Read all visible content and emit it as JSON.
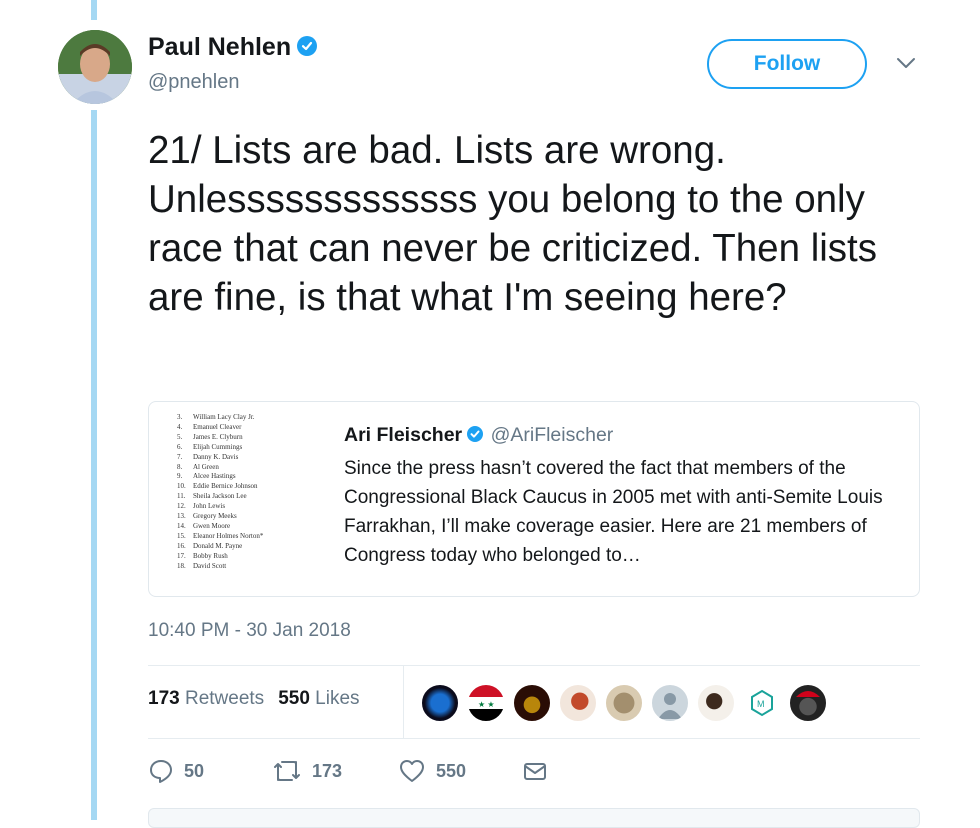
{
  "tweet": {
    "author_name": "Paul Nehlen",
    "handle": "@pnehlen",
    "follow_label": "Follow",
    "text": "21/ Lists are bad. Lists are wrong. Unlesssssssssssss you belong to the only race that can never be criticized. Then lists are fine, is that what I'm seeing here?",
    "timestamp": "10:40 PM - 30 Jan 2018"
  },
  "quote": {
    "author_name": "Ari Fleischer",
    "handle": "@AriFleischer",
    "text": "Since the press hasn’t covered the fact that members of the Congressional Black Caucus in 2005 met with anti-Semite Louis Farrakhan, I’ll make coverage easier. Here are 21 members of Congress today who belonged to…",
    "thumb_lines": [
      {
        "num": "3.",
        "name": "William Lacy Clay Jr."
      },
      {
        "num": "4.",
        "name": "Emanuel Cleaver"
      },
      {
        "num": "5.",
        "name": "James E. Clyburn"
      },
      {
        "num": "6.",
        "name": "Elijah Cummings"
      },
      {
        "num": "7.",
        "name": "Danny K. Davis"
      },
      {
        "num": "8.",
        "name": "Al Green"
      },
      {
        "num": "9.",
        "name": "Alcee Hastings"
      },
      {
        "num": "10.",
        "name": "Eddie Bernice Johnson"
      },
      {
        "num": "11.",
        "name": "Sheila Jackson Lee"
      },
      {
        "num": "12.",
        "name": "John Lewis"
      },
      {
        "num": "13.",
        "name": "Gregory Meeks"
      },
      {
        "num": "14.",
        "name": "Gwen Moore"
      },
      {
        "num": "15.",
        "name": "Eleanor Holmes Norton*"
      },
      {
        "num": "16.",
        "name": "Donald M. Payne"
      },
      {
        "num": "17.",
        "name": "Bobby Rush"
      },
      {
        "num": "18.",
        "name": "David Scott"
      }
    ]
  },
  "stats": {
    "retweets_count": "173",
    "retweets_label": "Retweets",
    "likes_count": "550",
    "likes_label": "Likes"
  },
  "actions": {
    "reply_count": "50",
    "retweet_count": "173",
    "like_count": "550"
  },
  "icons": {
    "verified": "verified-badge-icon",
    "chevron": "chevron-down-icon",
    "reply": "reply-icon",
    "retweet": "retweet-icon",
    "like": "heart-icon",
    "dm": "envelope-icon"
  },
  "colors": {
    "accent": "#1da1f2",
    "thread_line": "#a5d8f3",
    "muted_text": "#657786",
    "border": "#e1e8ed"
  }
}
